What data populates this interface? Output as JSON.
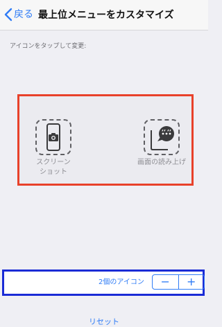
{
  "nav": {
    "back_label": "戻る",
    "title": "最上位メニューをカスタマイズ"
  },
  "section": {
    "label": "アイコンをタップして変更:"
  },
  "icons": [
    {
      "label_line1": "スクリーン",
      "label_line2": "ショット",
      "icon": "camera-icon"
    },
    {
      "label": "画面の読み上げ",
      "icon": "speech-bubble-icon"
    }
  ],
  "bottom": {
    "count_text": "2個のアイコン",
    "minus": "−",
    "plus": "+"
  },
  "reset": {
    "label": "リセット"
  },
  "colors": {
    "accent": "#2f7cf6",
    "highlight_red": "#e8412a",
    "highlight_blue": "#1a2bd6",
    "background": "#efeff4"
  }
}
